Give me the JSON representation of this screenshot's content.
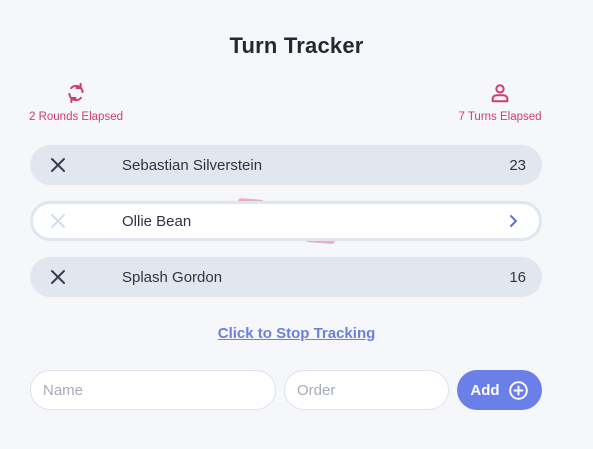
{
  "header": {
    "title": "Turn Tracker"
  },
  "stats": {
    "rounds_label": "2 Rounds Elapsed",
    "turns_label": "7 Turns Elapsed",
    "rounds_icon": "refresh-icon",
    "turns_icon": "person-icon"
  },
  "participants": [
    {
      "name": "Sebastian Silverstein",
      "order": "23",
      "active": false
    },
    {
      "name": "Ollie Bean",
      "order": "",
      "active": true
    },
    {
      "name": "Splash Gordon",
      "order": "16",
      "active": false
    }
  ],
  "actions": {
    "stop_link": "Click to Stop Tracking",
    "add_label": "Add"
  },
  "form": {
    "name_placeholder": "Name",
    "order_placeholder": "Order",
    "name_value": "",
    "order_value": ""
  },
  "colors": {
    "accent": "#cc3d74",
    "primary": "#6a80e8",
    "row_bg": "#e2e7ef",
    "page_bg": "#f5f7fb"
  }
}
